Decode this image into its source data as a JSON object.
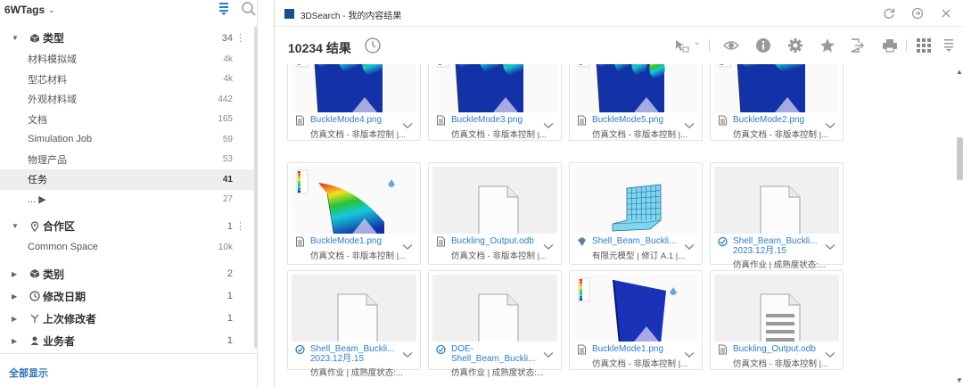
{
  "left": {
    "title": "6WTags",
    "show_all": "全部显示",
    "sections": [
      {
        "label": "类型",
        "count": "34",
        "icon": "cube-icon",
        "expanded": true,
        "items": [
          {
            "label": "材料模拟域",
            "count": "4k"
          },
          {
            "label": "型芯材料",
            "count": "4k"
          },
          {
            "label": "外观材料域",
            "count": "442"
          },
          {
            "label": "文档",
            "count": "165"
          },
          {
            "label": "Simulation Job",
            "count": "59"
          },
          {
            "label": "物理产品",
            "count": "53"
          },
          {
            "label": "任务",
            "count": "41"
          },
          {
            "label": "... ▶",
            "count": "27"
          }
        ]
      },
      {
        "label": "合作区",
        "count": "1",
        "icon": "pin-icon",
        "expanded": true,
        "items": [
          {
            "label": "Common Space",
            "count": "10k"
          }
        ]
      },
      {
        "label": "类别",
        "count": "2",
        "icon": "cube-icon",
        "expanded": false,
        "items": []
      },
      {
        "label": "修改日期",
        "count": "1",
        "icon": "clock-icon",
        "expanded": false,
        "items": []
      },
      {
        "label": "上次修改者",
        "count": "1",
        "icon": "user-icon",
        "expanded": false,
        "items": []
      },
      {
        "label": "业务者",
        "count": "1",
        "icon": "person-icon",
        "expanded": false,
        "items": []
      }
    ]
  },
  "window": {
    "title": "3DSearch - 我的内容结果",
    "result_count": "10234 结果"
  },
  "cards": [
    {
      "title": "BuckleMode4.png",
      "sub": "仿真文档 - 非版本控制 |...",
      "thumb": "mode4"
    },
    {
      "title": "BuckleMode3.png",
      "sub": "仿真文档 - 非版本控制 |...",
      "thumb": "mode3"
    },
    {
      "title": "BuckleMode5.png",
      "sub": "仿真文档 - 非版本控制 |...",
      "thumb": "mode5"
    },
    {
      "title": "BuckleMode2.png",
      "sub": "仿真文档 - 非版本控制 |...",
      "thumb": "mode2"
    },
    {
      "title": "BuckleMode1.png",
      "sub": "仿真文档 - 非版本控制 |...",
      "thumb": "mode1"
    },
    {
      "title": "Buckling_Output.odb",
      "sub": "仿真文档 - 非版本控制 |...",
      "thumb": "doc"
    },
    {
      "title": "Shell_Beam_Buckli...",
      "sub": "有限元模型 | 修订 A.1 |...",
      "thumb": "mesh"
    },
    {
      "title": "Shell_Beam_Buckli...\n2023.12月.15",
      "sub": "仿真作业 | 成熟度状态:...",
      "thumb": "doc"
    },
    {
      "title": "Shell_Beam_Buckli...\n2023.12月.15",
      "sub": "仿真作业 | 成熟度状态:...",
      "thumb": "doc"
    },
    {
      "title": "DOE-\nShell_Beam_Buckli...",
      "sub": "仿真作业 | 成熟度状态:...",
      "thumb": "doc"
    },
    {
      "title": "BuckleMode1.png",
      "sub": "仿真文档 - 非版本控制 |...",
      "thumb": "plate"
    },
    {
      "title": "Buckling_Output.odb",
      "sub": "仿真文档 - 非版本控制 |...",
      "thumb": "docl"
    }
  ],
  "colors": {
    "link": "#2e7dc4",
    "accent": "#2e6fb5",
    "contour_high": "#e8261c",
    "contour_mid": "#25c43a",
    "contour_low": "#1432a8"
  }
}
